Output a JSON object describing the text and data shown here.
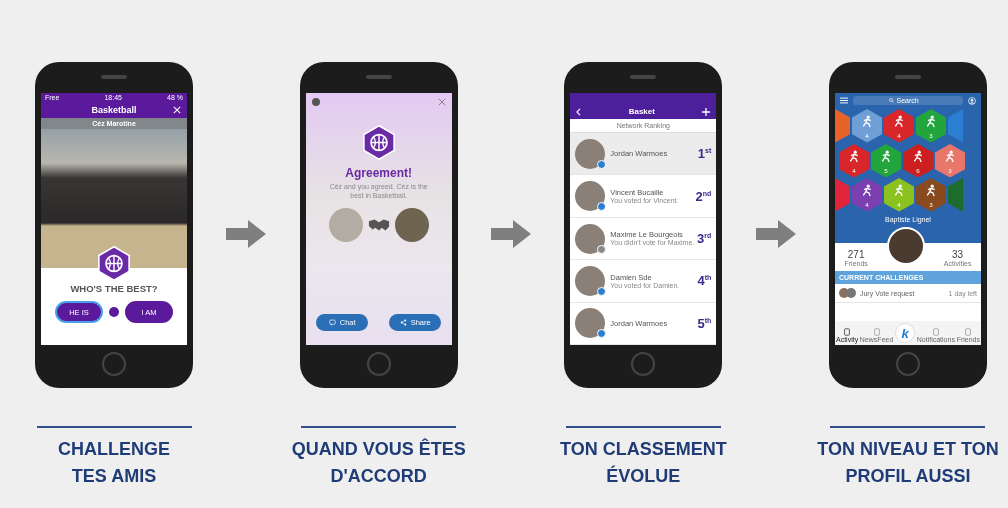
{
  "challenge_screen": {
    "status_bar": {
      "carrier": "Free",
      "time": "18:45",
      "battery": "48 %"
    },
    "title": "Basketball",
    "person_name": "Céz Marotine",
    "question": "WHO'S THE BEST?",
    "buttons": [
      {
        "label": "HE IS",
        "selected": true
      },
      {
        "label": "I AM",
        "selected": false
      }
    ]
  },
  "agreement_screen": {
    "title": "Agreement!",
    "message": "Céz and you agreed. Céz is the best in Basketball.",
    "buttons": [
      {
        "kind": "chat",
        "label": "Chat"
      },
      {
        "kind": "share",
        "label": "Share"
      }
    ]
  },
  "ranking_screen": {
    "title": "Basket",
    "subtitle": "Network Ranking",
    "rows": [
      {
        "name": "Jordan Warmoes",
        "rank": "1",
        "suffix": "st",
        "voted": true,
        "selected": true
      },
      {
        "name": "Vincent Bucaille",
        "note": "You voted for Vincent.",
        "rank": "2",
        "suffix": "nd",
        "voted": true,
        "selected": false
      },
      {
        "name": "Maxime Le Bourgeois",
        "note": "You didn't vote for Maxime.",
        "rank": "3",
        "suffix": "rd",
        "voted": false,
        "selected": false
      },
      {
        "name": "Damien Sde",
        "note": "You voted for Damien.",
        "rank": "4",
        "suffix": "th",
        "voted": true,
        "selected": false
      },
      {
        "name": "Jordan Warmoes",
        "rank": "5",
        "suffix": "th",
        "voted": true,
        "selected": false
      }
    ]
  },
  "profile_screen": {
    "search": {
      "placeholder": "Search"
    },
    "tile_rows": [
      [
        {
          "kind": "left_edge",
          "color": "#e8632a"
        },
        {
          "kind": "full",
          "color": "#6f9fd6",
          "count": "4"
        },
        {
          "kind": "full",
          "color": "#d8262a",
          "count": "4"
        },
        {
          "kind": "full",
          "color": "#23a53e",
          "count": "3"
        },
        {
          "kind": "right_edge",
          "color": "#2a7fd0"
        }
      ],
      [
        {
          "kind": "full",
          "color": "#d8262a",
          "count": "4"
        },
        {
          "kind": "full",
          "color": "#23a53e",
          "count": "5"
        },
        {
          "kind": "full",
          "color": "#cc1f1f",
          "count": "6"
        },
        {
          "kind": "full",
          "color": "#e9766a",
          "count": "3"
        }
      ],
      [
        {
          "kind": "left_edge",
          "color": "#e0243c"
        },
        {
          "kind": "full",
          "color": "#7b3fb0",
          "count": "4"
        },
        {
          "kind": "full",
          "color": "#8cc21f",
          "count": "4"
        },
        {
          "kind": "full",
          "color": "#8a4a1f",
          "count": "3"
        },
        {
          "kind": "right_edge",
          "color": "#1e6b2e"
        }
      ]
    ],
    "name": "Baptiste Lignel",
    "stats": [
      {
        "value": "271",
        "label": "Friends"
      },
      {
        "value": "33",
        "label": "Activities"
      }
    ],
    "section_title": "CURRENT CHALLENGES",
    "challenge": {
      "text": "Jury Vote request",
      "time": "1 day left"
    },
    "center_button": "k",
    "tabs": [
      {
        "label": "Activity",
        "selected": true
      },
      {
        "label": "NewsFeed",
        "selected": false
      },
      {
        "label": "Notifications",
        "selected": false
      },
      {
        "label": "Friends",
        "selected": false
      }
    ]
  },
  "captions": [
    {
      "lines": [
        "CHALLENGE",
        "TES AMIS"
      ]
    },
    {
      "lines": [
        "QUAND VOUS ÊTES",
        "D'ACCORD"
      ]
    },
    {
      "lines": [
        "TON CLASSEMENT",
        "ÉVOLUE"
      ]
    },
    {
      "lines": [
        "TON NIVEAU ET TON",
        "PROFIL AUSSI"
      ]
    }
  ]
}
